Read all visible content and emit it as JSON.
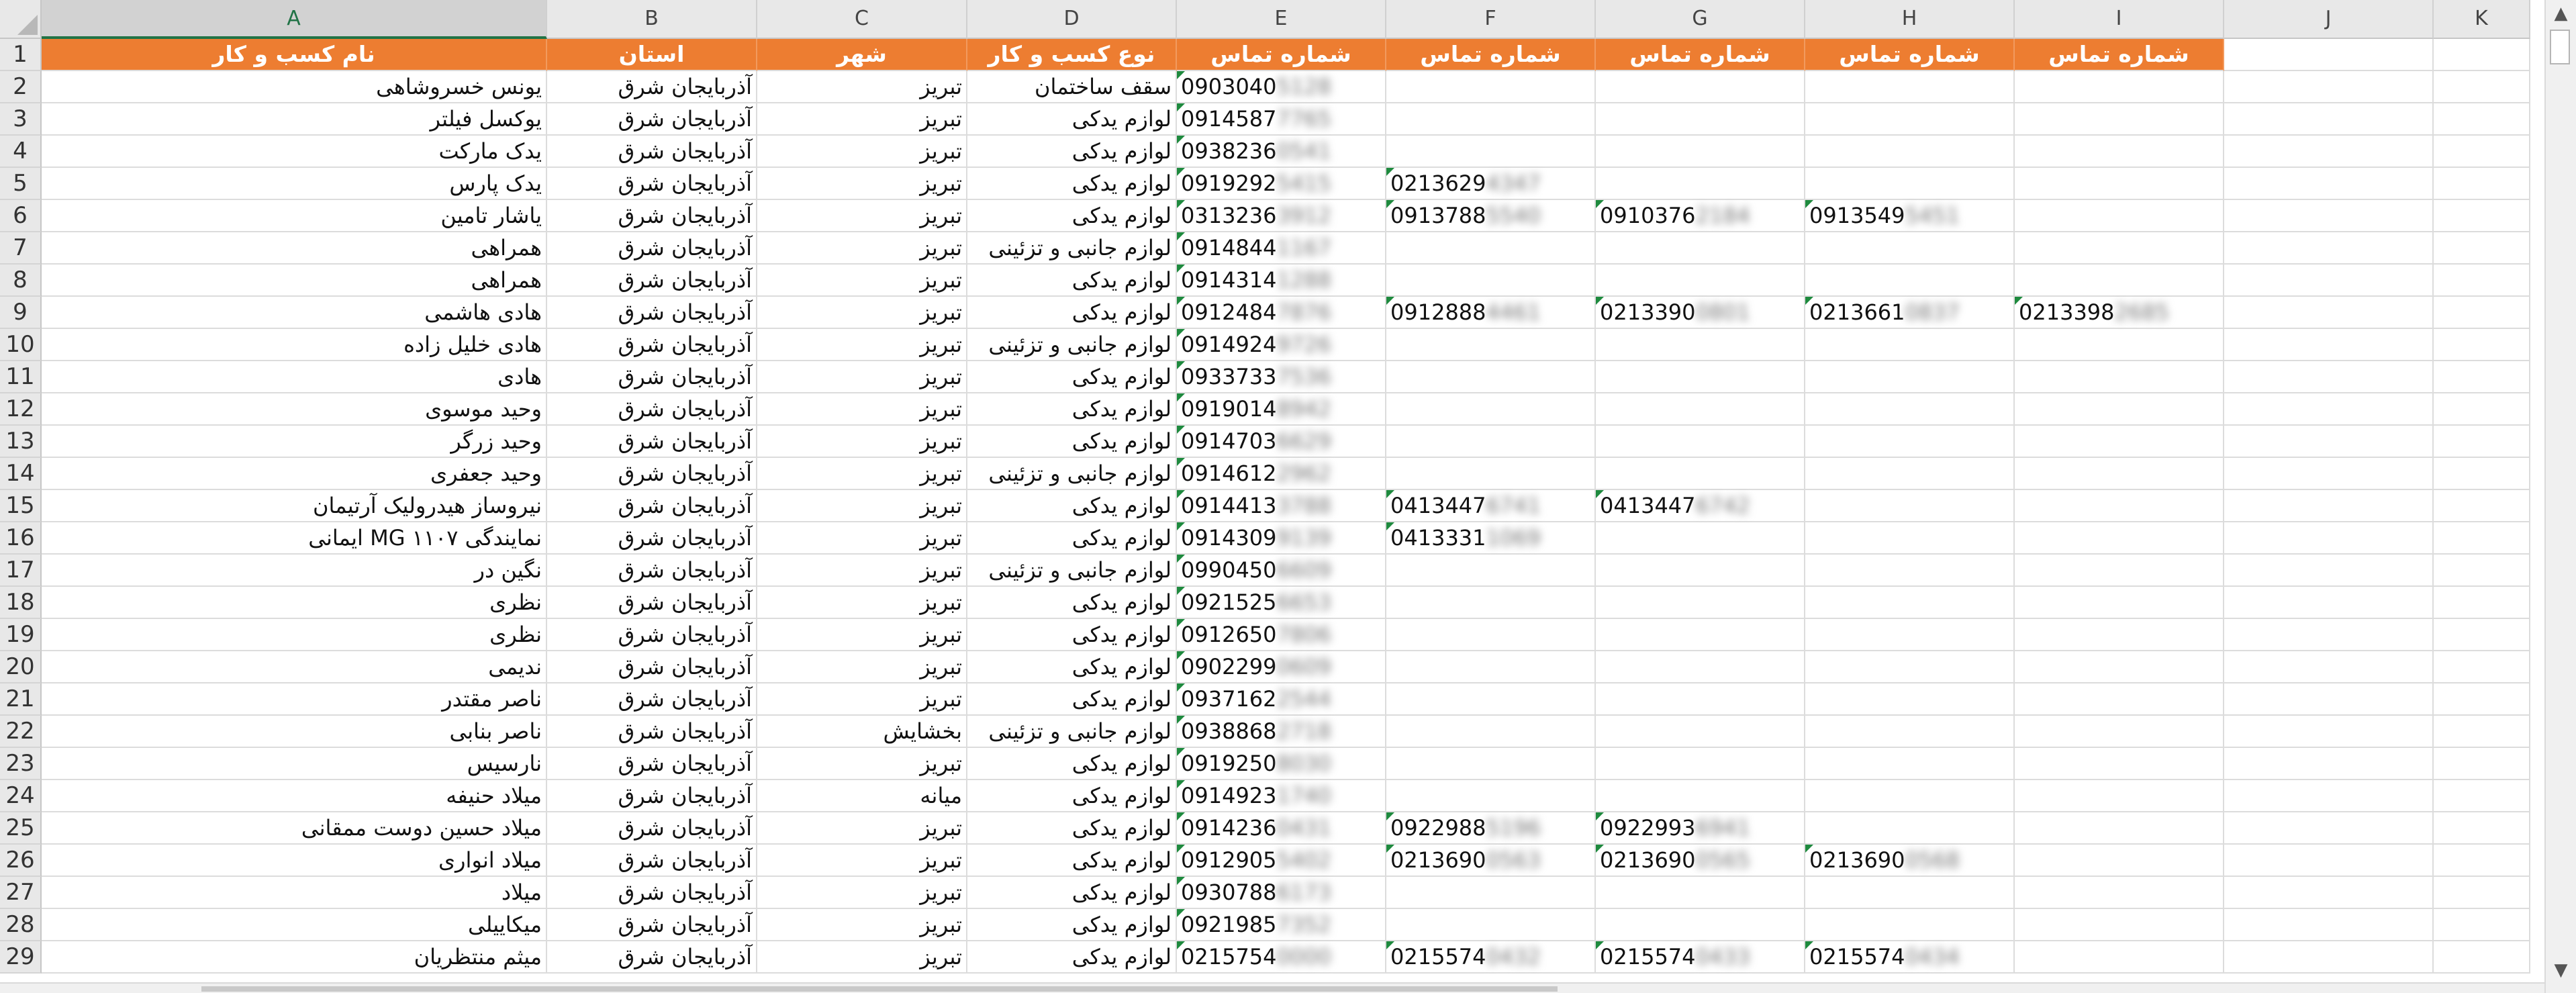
{
  "column_letters": [
    "A",
    "B",
    "C",
    "D",
    "E",
    "F",
    "G",
    "H",
    "I",
    "J",
    "K"
  ],
  "selected_column": "A",
  "colors": {
    "header_fill": "#ed7d31",
    "header_text": "#ffffff",
    "flag": "#1e8a3e",
    "selected_col": "#217346"
  },
  "header_row": {
    "number": "1",
    "cells": [
      "نام کسب و کار",
      "استان",
      "شهر",
      "نوع کسب و کار",
      "شماره تماس",
      "شماره تماس",
      "شماره تماس",
      "شماره تماس",
      "شماره تماس"
    ]
  },
  "rows": [
    {
      "n": "2",
      "name": "یونس خسروشاهی",
      "province": "آذربایجان شرق",
      "city": "تبریز",
      "type": "سقف ساختمان",
      "p1": "0903040",
      "p1b": "5128",
      "p2": "",
      "p2b": "",
      "p3": "",
      "p3b": "",
      "p4": "",
      "p4b": "",
      "p5": "",
      "p5b": ""
    },
    {
      "n": "3",
      "name": "یوکسل فیلتر",
      "province": "آذربایجان شرق",
      "city": "تبریز",
      "type": "لوازم یدکی",
      "p1": "0914587",
      "p1b": "7765",
      "p2": "",
      "p2b": "",
      "p3": "",
      "p3b": "",
      "p4": "",
      "p4b": "",
      "p5": "",
      "p5b": ""
    },
    {
      "n": "4",
      "name": "یدک مارکت",
      "province": "آذربایجان شرق",
      "city": "تبریز",
      "type": "لوازم یدکی",
      "p1": "0938236",
      "p1b": "0541",
      "p2": "",
      "p2b": "",
      "p3": "",
      "p3b": "",
      "p4": "",
      "p4b": "",
      "p5": "",
      "p5b": ""
    },
    {
      "n": "5",
      "name": "یدک پارس",
      "province": "آذربایجان شرق",
      "city": "تبریز",
      "type": "لوازم یدکی",
      "p1": "0919292",
      "p1b": "5415",
      "p2": "0213629",
      "p2b": "4347",
      "p3": "",
      "p3b": "",
      "p4": "",
      "p4b": "",
      "p5": "",
      "p5b": ""
    },
    {
      "n": "6",
      "name": "یاشار تامین",
      "province": "آذربایجان شرق",
      "city": "تبریز",
      "type": "لوازم یدکی",
      "p1": "0313236",
      "p1b": "3912",
      "p2": "0913788",
      "p2b": "5540",
      "p3": "0910376",
      "p3b": "2184",
      "p4": "0913549",
      "p4b": "5451",
      "p5": "",
      "p5b": ""
    },
    {
      "n": "7",
      "name": "همراهی",
      "province": "آذربایجان شرق",
      "city": "تبریز",
      "type": "لوازم جانبی و تزئینی",
      "p1": "0914844",
      "p1b": "1167",
      "p2": "",
      "p2b": "",
      "p3": "",
      "p3b": "",
      "p4": "",
      "p4b": "",
      "p5": "",
      "p5b": ""
    },
    {
      "n": "8",
      "name": "همراهی",
      "province": "آذربایجان شرق",
      "city": "تبریز",
      "type": "لوازم یدکی",
      "p1": "0914314",
      "p1b": "1288",
      "p2": "",
      "p2b": "",
      "p3": "",
      "p3b": "",
      "p4": "",
      "p4b": "",
      "p5": "",
      "p5b": ""
    },
    {
      "n": "9",
      "name": "هادی هاشمی",
      "province": "آذربایجان شرق",
      "city": "تبریز",
      "type": "لوازم یدکی",
      "p1": "0912484",
      "p1b": "7876",
      "p2": "0912888",
      "p2b": "4461",
      "p3": "0213390",
      "p3b": "0801",
      "p4": "0213661",
      "p4b": "0837",
      "p5": "0213398",
      "p5b": "2685"
    },
    {
      "n": "10",
      "name": "هادی خلیل زاده",
      "province": "آذربایجان شرق",
      "city": "تبریز",
      "type": "لوازم جانبی و تزئینی",
      "p1": "0914924",
      "p1b": "9726",
      "p2": "",
      "p2b": "",
      "p3": "",
      "p3b": "",
      "p4": "",
      "p4b": "",
      "p5": "",
      "p5b": ""
    },
    {
      "n": "11",
      "name": "هادی",
      "province": "آذربایجان شرق",
      "city": "تبریز",
      "type": "لوازم یدکی",
      "p1": "0933733",
      "p1b": "7536",
      "p2": "",
      "p2b": "",
      "p3": "",
      "p3b": "",
      "p4": "",
      "p4b": "",
      "p5": "",
      "p5b": ""
    },
    {
      "n": "12",
      "name": "وحید موسوی",
      "province": "آذربایجان شرق",
      "city": "تبریز",
      "type": "لوازم یدکی",
      "p1": "0919014",
      "p1b": "8942",
      "p2": "",
      "p2b": "",
      "p3": "",
      "p3b": "",
      "p4": "",
      "p4b": "",
      "p5": "",
      "p5b": ""
    },
    {
      "n": "13",
      "name": "وحید زرگر",
      "province": "آذربایجان شرق",
      "city": "تبریز",
      "type": "لوازم یدکی",
      "p1": "0914703",
      "p1b": "6629",
      "p2": "",
      "p2b": "",
      "p3": "",
      "p3b": "",
      "p4": "",
      "p4b": "",
      "p5": "",
      "p5b": ""
    },
    {
      "n": "14",
      "name": "وحید جعفری",
      "province": "آذربایجان شرق",
      "city": "تبریز",
      "type": "لوازم جانبی و تزئینی",
      "p1": "0914612",
      "p1b": "2962",
      "p2": "",
      "p2b": "",
      "p3": "",
      "p3b": "",
      "p4": "",
      "p4b": "",
      "p5": "",
      "p5b": ""
    },
    {
      "n": "15",
      "name": "نیروساز هیدرولیک آرتیمان",
      "province": "آذربایجان شرق",
      "city": "تبریز",
      "type": "لوازم یدکی",
      "p1": "0914413",
      "p1b": "3788",
      "p2": "0413447",
      "p2b": "6741",
      "p3": "0413447",
      "p3b": "6742",
      "p4": "",
      "p4b": "",
      "p5": "",
      "p5b": ""
    },
    {
      "n": "16",
      "name": "نمایندگی MG ۱۱۰۷ ایمانی",
      "province": "آذربایجان شرق",
      "city": "تبریز",
      "type": "لوازم یدکی",
      "p1": "0914309",
      "p1b": "9139",
      "p2": "0413331",
      "p2b": "1069",
      "p3": "",
      "p3b": "",
      "p4": "",
      "p4b": "",
      "p5": "",
      "p5b": ""
    },
    {
      "n": "17",
      "name": "نگین در",
      "province": "آذربایجان شرق",
      "city": "تبریز",
      "type": "لوازم جانبی و تزئینی",
      "p1": "0990450",
      "p1b": "6609",
      "p2": "",
      "p2b": "",
      "p3": "",
      "p3b": "",
      "p4": "",
      "p4b": "",
      "p5": "",
      "p5b": ""
    },
    {
      "n": "18",
      "name": "نظری",
      "province": "آذربایجان شرق",
      "city": "تبریز",
      "type": "لوازم یدکی",
      "p1": "0921525",
      "p1b": "6653",
      "p2": "",
      "p2b": "",
      "p3": "",
      "p3b": "",
      "p4": "",
      "p4b": "",
      "p5": "",
      "p5b": ""
    },
    {
      "n": "19",
      "name": "نظری",
      "province": "آذربایجان شرق",
      "city": "تبریز",
      "type": "لوازم یدکی",
      "p1": "0912650",
      "p1b": "7806",
      "p2": "",
      "p2b": "",
      "p3": "",
      "p3b": "",
      "p4": "",
      "p4b": "",
      "p5": "",
      "p5b": ""
    },
    {
      "n": "20",
      "name": "ندیمی",
      "province": "آذربایجان شرق",
      "city": "تبریز",
      "type": "لوازم یدکی",
      "p1": "0902299",
      "p1b": "0609",
      "p2": "",
      "p2b": "",
      "p3": "",
      "p3b": "",
      "p4": "",
      "p4b": "",
      "p5": "",
      "p5b": ""
    },
    {
      "n": "21",
      "name": "ناصر مقتدر",
      "province": "آذربایجان شرق",
      "city": "تبریز",
      "type": "لوازم یدکی",
      "p1": "0937162",
      "p1b": "2544",
      "p2": "",
      "p2b": "",
      "p3": "",
      "p3b": "",
      "p4": "",
      "p4b": "",
      "p5": "",
      "p5b": ""
    },
    {
      "n": "22",
      "name": "ناصر بنابی",
      "province": "آذربایجان شرق",
      "city": "بخشایش",
      "type": "لوازم جانبی و تزئینی",
      "p1": "0938868",
      "p1b": "2718",
      "p2": "",
      "p2b": "",
      "p3": "",
      "p3b": "",
      "p4": "",
      "p4b": "",
      "p5": "",
      "p5b": ""
    },
    {
      "n": "23",
      "name": "نارسیس",
      "province": "آذربایجان شرق",
      "city": "تبریز",
      "type": "لوازم یدکی",
      "p1": "0919250",
      "p1b": "8030",
      "p2": "",
      "p2b": "",
      "p3": "",
      "p3b": "",
      "p4": "",
      "p4b": "",
      "p5": "",
      "p5b": ""
    },
    {
      "n": "24",
      "name": "میلاد حنیفه",
      "province": "آذربایجان شرق",
      "city": "میانه",
      "type": "لوازم یدکی",
      "p1": "0914923",
      "p1b": "1740",
      "p2": "",
      "p2b": "",
      "p3": "",
      "p3b": "",
      "p4": "",
      "p4b": "",
      "p5": "",
      "p5b": ""
    },
    {
      "n": "25",
      "name": "میلاد حسین دوست ممقانی",
      "province": "آذربایجان شرق",
      "city": "تبریز",
      "type": "لوازم یدکی",
      "p1": "0914236",
      "p1b": "0431",
      "p2": "0922988",
      "p2b": "5196",
      "p3": "0922993",
      "p3b": "6941",
      "p4": "",
      "p4b": "",
      "p5": "",
      "p5b": ""
    },
    {
      "n": "26",
      "name": "میلاد انواری",
      "province": "آذربایجان شرق",
      "city": "تبریز",
      "type": "لوازم یدکی",
      "p1": "0912905",
      "p1b": "5402",
      "p2": "0213690",
      "p2b": "0563",
      "p3": "0213690",
      "p3b": "0565",
      "p4": "0213690",
      "p4b": "0568",
      "p5": "",
      "p5b": ""
    },
    {
      "n": "27",
      "name": "میلاد",
      "province": "آذربایجان شرق",
      "city": "تبریز",
      "type": "لوازم یدکی",
      "p1": "0930788",
      "p1b": "6173",
      "p2": "",
      "p2b": "",
      "p3": "",
      "p3b": "",
      "p4": "",
      "p4b": "",
      "p5": "",
      "p5b": ""
    },
    {
      "n": "28",
      "name": "میکاییلی",
      "province": "آذربایجان شرق",
      "city": "تبریز",
      "type": "لوازم یدکی",
      "p1": "0921985",
      "p1b": "7352",
      "p2": "",
      "p2b": "",
      "p3": "",
      "p3b": "",
      "p4": "",
      "p4b": "",
      "p5": "",
      "p5b": ""
    },
    {
      "n": "29",
      "name": "میثم منتظریان",
      "province": "آذربایجان شرق",
      "city": "تبریز",
      "type": "لوازم یدکی",
      "p1": "0215754",
      "p1b": "0000",
      "p2": "0215574",
      "p2b": "0432",
      "p3": "0215574",
      "p3b": "0433",
      "p4": "0215574",
      "p4b": "0434",
      "p5": "",
      "p5b": ""
    }
  ],
  "scrollbar": {
    "up_icon": "up-arrow-icon",
    "down_icon": "down-arrow-icon"
  }
}
